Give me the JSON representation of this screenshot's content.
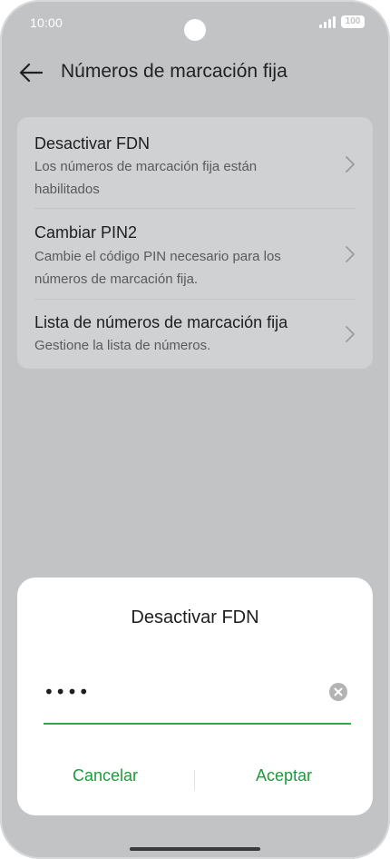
{
  "status_bar": {
    "time": "10:00",
    "battery": "100",
    "icons": [
      "signal-icon",
      "battery-icon"
    ]
  },
  "header": {
    "title": "Números de marcación fija",
    "back_icon": "arrow-left-icon"
  },
  "settings": {
    "items": [
      {
        "title": "Desactivar FDN",
        "description": "Los números de marcación fija están habilitados"
      },
      {
        "title": "Cambiar PIN2",
        "description": "Cambie el código PIN necesario para los números de marcación fija."
      },
      {
        "title": "Lista de números de marcación fija",
        "description": "Gestione la lista de números."
      }
    ],
    "chevron_icon": "chevron-right-icon"
  },
  "dialog": {
    "title": "Desactivar FDN",
    "pin_value": "••••",
    "clear_icon": "clear-icon",
    "cancel_label": "Cancelar",
    "accept_label": "Aceptar"
  },
  "colors": {
    "accent": "#1c9b3a",
    "underline": "#2ea84a",
    "scrim_background": "#c2c3c5",
    "card_background": "#d0d1d3"
  }
}
